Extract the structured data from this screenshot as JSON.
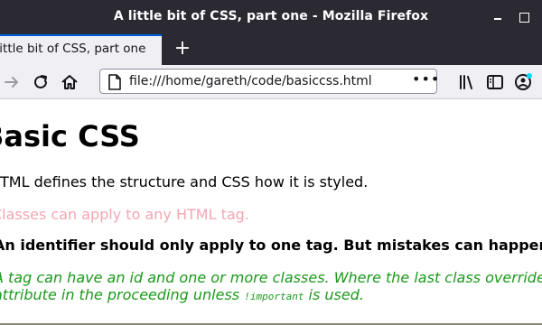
{
  "window": {
    "title": "A little bit of CSS, part one - Mozilla Firefox"
  },
  "tab": {
    "label": "A little bit of CSS, part one",
    "new_tab_label": "+"
  },
  "navbar": {
    "url": "file:///home/gareth/code/basiccss.html",
    "page_actions_label": "•••"
  },
  "page": {
    "heading": "Basic CSS",
    "p1": "HTML defines the structure and CSS how it is styled.",
    "p2": "Classes can apply to any HTML tag.",
    "p3": "An identifier should only apply to one tag. But mistakes can happen.",
    "p4": "A tag can have an id and one or more classes. Where the last class overrides a",
    "p5_start": "attribute in the proceeding unless ",
    "p5_code": "!important",
    "p5_end": " is used."
  },
  "colors": {
    "chrome_dark": "#2b2a33",
    "toolbar": "#f0f0f4",
    "class_text": "#f4a6b2",
    "green_text": "#1a9a1a",
    "tab_accent": "#0060df"
  }
}
